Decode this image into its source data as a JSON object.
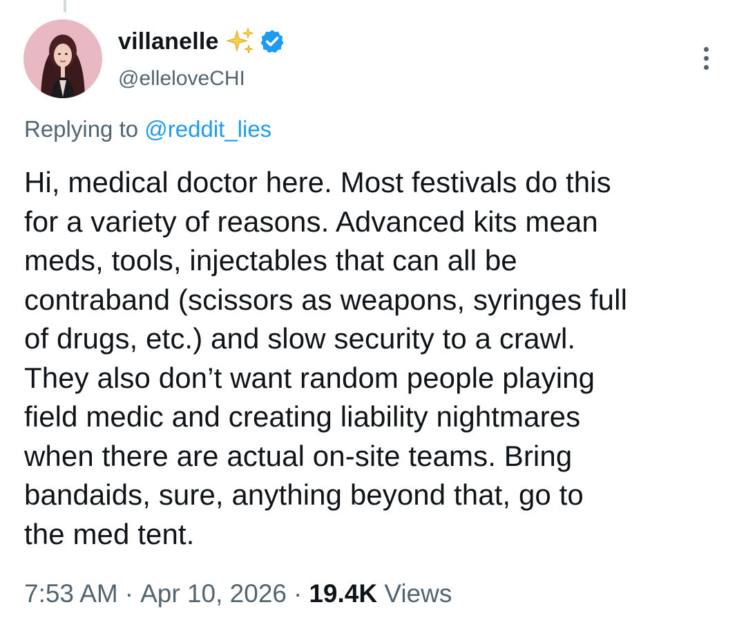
{
  "author": {
    "display_name": "villanelle",
    "handle": "@elleloveCHI",
    "emoji": "sparkles-icon",
    "verified_badge": "verified-icon",
    "avatar_icon": "avatar-photo"
  },
  "reply": {
    "prefix": "Replying to ",
    "mention": "@reddit_lies"
  },
  "tweet": {
    "lines": [
      "Hi, medical doctor here. Most festivals do this",
      "for a variety of reasons. Advanced kits mean",
      "meds, tools, injectables that can all be",
      "contraband (scissors as weapons, syringes full",
      "of drugs, etc.) and slow security to a crawl.",
      "They also don’t want random people playing",
      "field medic and creating liability nightmares",
      "when there are actual on-site teams. Bring",
      "bandaids, sure, anything beyond that, go to",
      "the med tent."
    ]
  },
  "meta": {
    "time": "7:53 AM",
    "separator": "·",
    "date": "Apr 10, 2026",
    "views_count": "19.4K",
    "views_label": "Views"
  },
  "colors": {
    "text_primary": "#0f1419",
    "text_secondary": "#536471",
    "accent": "#1d9bf0"
  }
}
